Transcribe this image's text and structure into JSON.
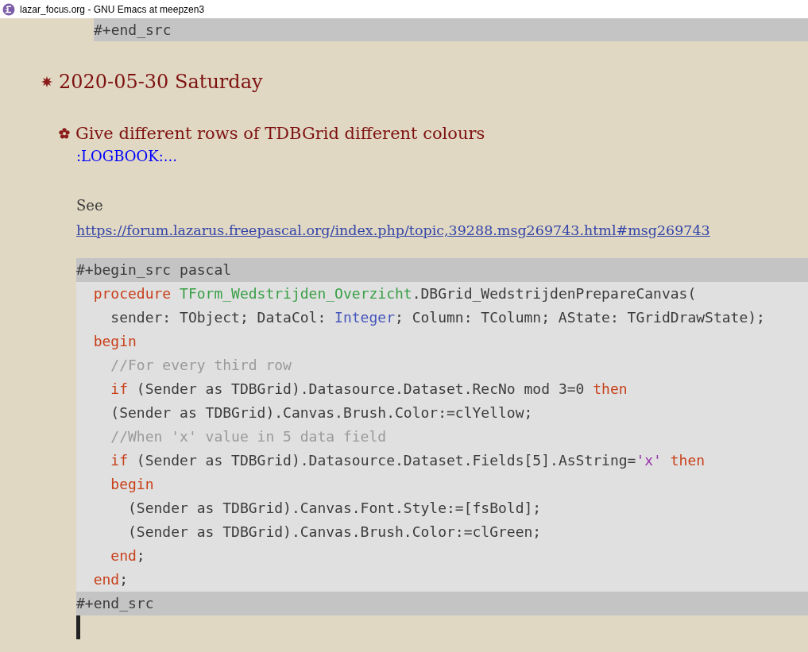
{
  "window": {
    "title": "lazar_focus.org - GNU Emacs at meepzen3"
  },
  "prev_block": {
    "end_line": "#+end_src"
  },
  "heading_1": {
    "text": "2020-05-30 Saturday"
  },
  "heading_2": {
    "text": "Give different rows of TDBGrid different colours"
  },
  "drawer": {
    "text": ":LOGBOOK:..."
  },
  "paragraph": {
    "text": "See"
  },
  "link": {
    "text": "https://forum.lazarus.freepascal.org/index.php/topic,39288.msg269743.html#msg269743"
  },
  "src_block": {
    "begin_line": "#+begin_src pascal",
    "end_line": "#+end_src",
    "lines": [
      [
        {
          "text": "  procedure",
          "kind": "keyword"
        },
        {
          "text": " TForm_Wedstrijden_Overzicht",
          "kind": "type"
        },
        {
          "text": ".DBGrid_WedstrijdenPrepareCanvas("
        }
      ],
      [
        {
          "text": "    sender: TObject; DataCol: "
        },
        {
          "text": "Integer",
          "kind": "builtin"
        },
        {
          "text": "; Column: TColumn; AState: TGridDrawState);"
        }
      ],
      [
        {
          "text": "  begin",
          "kind": "keyword"
        }
      ],
      [
        {
          "text": "    //For every third row",
          "kind": "comment"
        }
      ],
      [
        {
          "text": "    if",
          "kind": "keyword"
        },
        {
          "text": " (Sender as TDBGrid).Datasource.Dataset.RecNo mod 3=0"
        },
        {
          "text": " then",
          "kind": "keyword"
        }
      ],
      [
        {
          "text": "    (Sender as TDBGrid).Canvas.Brush.Color:=clYellow;"
        }
      ],
      [
        {
          "text": "    //When 'x' value in 5 data field",
          "kind": "comment"
        }
      ],
      [
        {
          "text": "    if",
          "kind": "keyword"
        },
        {
          "text": " (Sender as TDBGrid).Datasource.Dataset.Fields[5].AsString="
        },
        {
          "text": "'x'",
          "kind": "string"
        },
        {
          "text": " then",
          "kind": "keyword"
        }
      ],
      [
        {
          "text": "    begin",
          "kind": "keyword"
        }
      ],
      [
        {
          "text": "      (Sender as TDBGrid).Canvas.Font.Style:=[fsBold];"
        }
      ],
      [
        {
          "text": "      (Sender as TDBGrid).Canvas.Brush.Color:=clGreen;"
        }
      ],
      [
        {
          "text": "    end",
          "kind": "keyword"
        },
        {
          "text": ";"
        }
      ],
      [
        {
          "text": "  end",
          "kind": "keyword"
        },
        {
          "text": ";"
        }
      ]
    ]
  }
}
